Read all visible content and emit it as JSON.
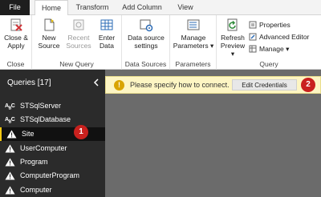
{
  "tabs": [
    "File",
    "Home",
    "Transform",
    "Add Column",
    "View"
  ],
  "ribbon": {
    "close": {
      "button": "Close &",
      "button2": "Apply",
      "group": "Close"
    },
    "new_query": {
      "new_source": "New",
      "new_source2": "Source",
      "recent_sources": "Recent",
      "recent_sources2": "Sources",
      "enter_data": "Enter",
      "enter_data2": "Data",
      "group": "New Query"
    },
    "data_sources": {
      "button": "Data source",
      "button2": "settings",
      "group": "Data Sources"
    },
    "parameters": {
      "button": "Manage",
      "button2": "Parameters",
      "group": "Parameters"
    },
    "query": {
      "refresh": "Refresh",
      "refresh2": "Preview",
      "properties": "Properties",
      "advanced_editor": "Advanced Editor",
      "manage": "Manage",
      "group": "Query"
    }
  },
  "queries_pane": {
    "title": "Queries [17]",
    "items": [
      {
        "label": "STSqlServer",
        "icon": "abc-parameter-icon"
      },
      {
        "label": "STSqlDatabase",
        "icon": "abc-parameter-icon"
      },
      {
        "label": "Site",
        "icon": "warning-icon"
      },
      {
        "label": "UserComputer",
        "icon": "warning-icon"
      },
      {
        "label": "Program",
        "icon": "warning-icon"
      },
      {
        "label": "ComputerProgram",
        "icon": "warning-icon"
      },
      {
        "label": "Computer",
        "icon": "warning-icon"
      }
    ]
  },
  "warning_bar": {
    "message": "Please specify how to connect.",
    "button": "Edit Credentials"
  },
  "badges": [
    "1",
    "2"
  ],
  "colors": {
    "accent": "#f2c811",
    "badge": "#c9211e",
    "pane": "#2b2b2b",
    "main": "#6b6b6b",
    "warn_bg": "#fdf5c3"
  }
}
